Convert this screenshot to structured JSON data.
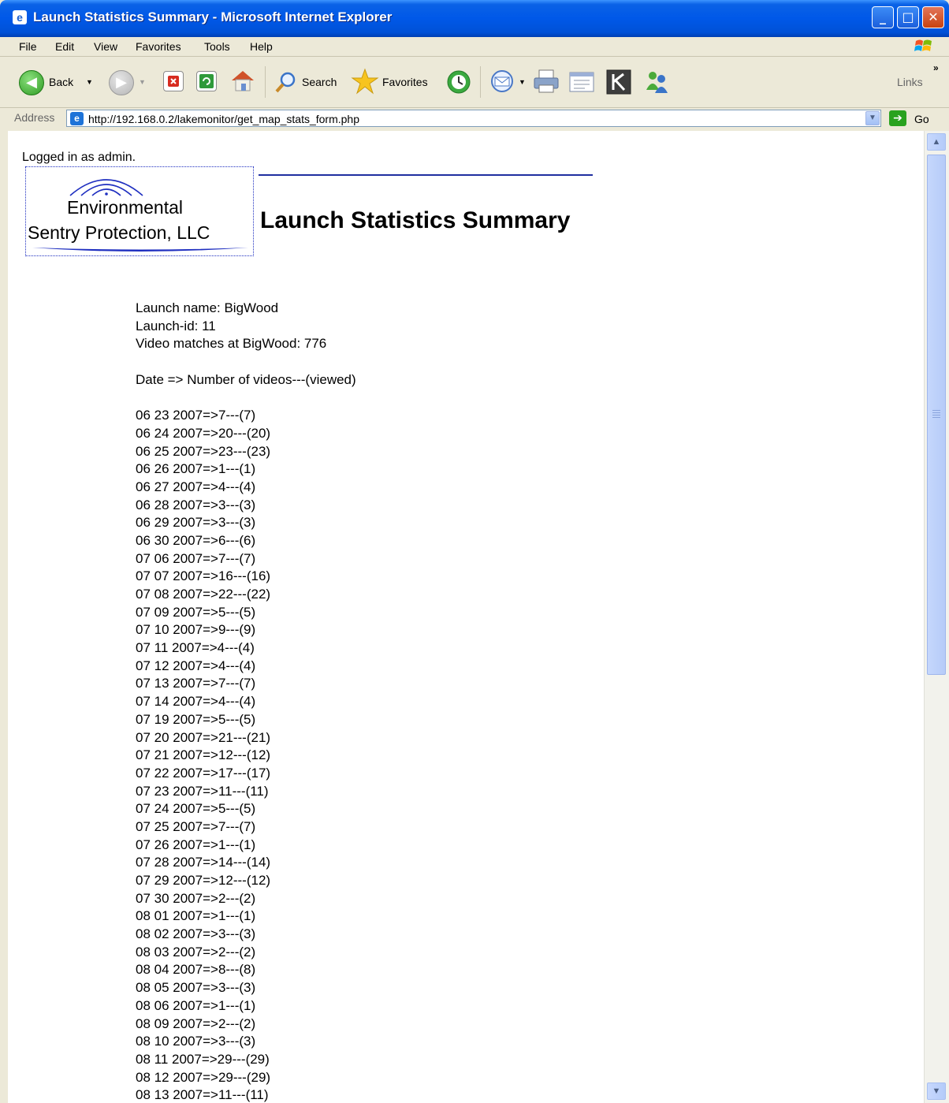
{
  "window": {
    "title": "Launch Statistics Summary - Microsoft Internet Explorer",
    "controls": {
      "minimize": "_",
      "maximize": "□",
      "close": "✕"
    }
  },
  "menu": [
    "File",
    "Edit",
    "View",
    "Favorites",
    "Tools",
    "Help"
  ],
  "toolbar": {
    "back_label": "Back",
    "search_label": "Search",
    "favorites_label": "Favorites",
    "links_label": "Links",
    "overflow_label": "»"
  },
  "address": {
    "label": "Address",
    "url": "http://192.168.0.2/lakemonitor/get_map_stats_form.php",
    "go_label": "Go"
  },
  "page": {
    "logged_in": "Logged in as admin.",
    "logo": {
      "line1": "Environmental",
      "line2": "Sentry Protection, LLC"
    },
    "title": "Launch Statistics Summary",
    "launch_name": "Launch name: BigWood",
    "launch_id": "Launch-id: 11",
    "video_matches": "Video matches at BigWood: 776",
    "legend": "Date => Number of videos---(viewed)",
    "rows": [
      "06 23 2007=>7---(7)",
      "06 24 2007=>20---(20)",
      "06 25 2007=>23---(23)",
      "06 26 2007=>1---(1)",
      "06 27 2007=>4---(4)",
      "06 28 2007=>3---(3)",
      "06 29 2007=>3---(3)",
      "06 30 2007=>6---(6)",
      "07 06 2007=>7---(7)",
      "07 07 2007=>16---(16)",
      "07 08 2007=>22---(22)",
      "07 09 2007=>5---(5)",
      "07 10 2007=>9---(9)",
      "07 11 2007=>4---(4)",
      "07 12 2007=>4---(4)",
      "07 13 2007=>7---(7)",
      "07 14 2007=>4---(4)",
      "07 19 2007=>5---(5)",
      "07 20 2007=>21---(21)",
      "07 21 2007=>12---(12)",
      "07 22 2007=>17---(17)",
      "07 23 2007=>11---(11)",
      "07 24 2007=>5---(5)",
      "07 25 2007=>7---(7)",
      "07 26 2007=>1---(1)",
      "07 28 2007=>14---(14)",
      "07 29 2007=>12---(12)",
      "07 30 2007=>2---(2)",
      "08 01 2007=>1---(1)",
      "08 02 2007=>3---(3)",
      "08 03 2007=>2---(2)",
      "08 04 2007=>8---(8)",
      "08 05 2007=>3---(3)",
      "08 06 2007=>1---(1)",
      "08 09 2007=>2---(2)",
      "08 10 2007=>3---(3)",
      "08 11 2007=>29---(29)",
      "08 12 2007=>29---(29)",
      "08 13 2007=>11---(11)"
    ]
  },
  "colors": {
    "titlebar": "#0058e8",
    "window_bg": "#ece9d8",
    "rule": "#1f2fa0"
  }
}
